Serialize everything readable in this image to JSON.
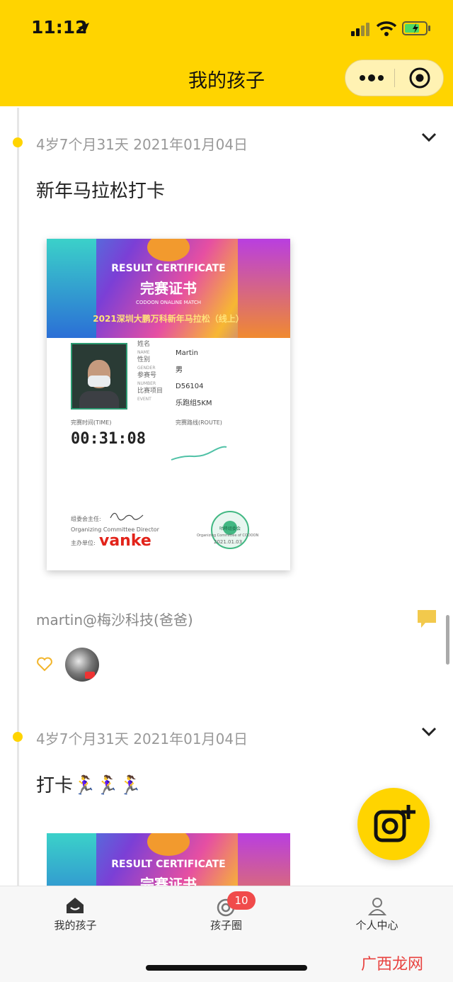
{
  "status_bar": {
    "time": "11:12"
  },
  "nav": {
    "title": "我的孩子"
  },
  "posts": [
    {
      "date": "4岁7个月31天 2021年01月04日",
      "text": "新年马拉松打卡",
      "certificate": {
        "title_en": "RESULT CERTIFICATE",
        "title_cn": "完赛证书",
        "subtitle_en": "CODOON ONALINE MATCH",
        "event_name": "2021深圳大鹏万科新年马拉松（线上）",
        "fields": [
          {
            "label": "姓名",
            "label_en": "NAME",
            "value": "Martin"
          },
          {
            "label": "性别",
            "label_en": "GENDER",
            "value": "男"
          },
          {
            "label": "参赛号",
            "label_en": "NUMBER",
            "value": "D56104"
          },
          {
            "label": "比赛项目",
            "label_en": "EVENT",
            "value": "乐跑组5KM"
          }
        ],
        "time_label": "完赛时间(TIME)",
        "time_value": "00:31:08",
        "route_label": "完赛路线(ROUTE)",
        "director_label": "组委会主任:",
        "director_en": "Organizing Committee Director",
        "host_label": "主办单位:",
        "host_brand": "vanke",
        "seal_text": "咕咚组委会",
        "seal_sub": "Organizing Committee of CODOON",
        "seal_date": "2021.01.03"
      },
      "author": "martin@梅沙科技(爸爸)"
    },
    {
      "date": "4岁7个月31天 2021年01月04日",
      "text": "打卡🏃‍♀️🏃‍♀️🏃‍♀️",
      "certificate": {
        "title_en": "RESULT CERTIFICATE",
        "title_cn": "完赛证书"
      }
    }
  ],
  "tabbar": {
    "tabs": [
      {
        "label": "我的孩子",
        "icon": "home-icon"
      },
      {
        "label": "孩子圈",
        "icon": "circle-icon",
        "badge": "10"
      },
      {
        "label": "个人中心",
        "icon": "person-icon"
      }
    ]
  },
  "watermark": "广西龙网",
  "colors": {
    "brand_yellow": "#FFD400",
    "badge_red": "#F04B4B",
    "comment_icon": "#F2C94C"
  }
}
